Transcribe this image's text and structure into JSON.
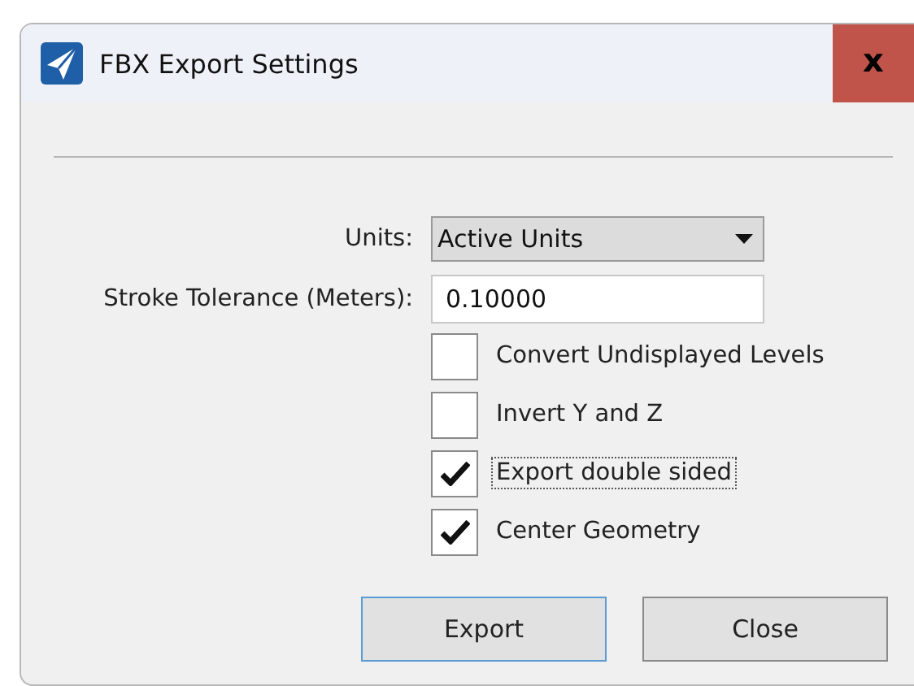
{
  "window": {
    "title": "FBX Export Settings",
    "close_label": "x"
  },
  "fields": [
    {
      "kind": "dropdown",
      "label": "Units:",
      "value": "Active Units"
    },
    {
      "kind": "text",
      "label": "Stroke Tolerance (Meters):",
      "value": "0.10000"
    }
  ],
  "options": [
    {
      "label": "Convert Undisplayed Levels",
      "checked": false,
      "focused": false
    },
    {
      "label": "Invert Y and Z",
      "checked": false,
      "focused": false
    },
    {
      "label": "Export double sided",
      "checked": true,
      "focused": true
    },
    {
      "label": "Center Geometry",
      "checked": true,
      "focused": false
    }
  ],
  "buttons": [
    {
      "label": "Export",
      "default": true
    },
    {
      "label": "Close",
      "default": false
    }
  ]
}
